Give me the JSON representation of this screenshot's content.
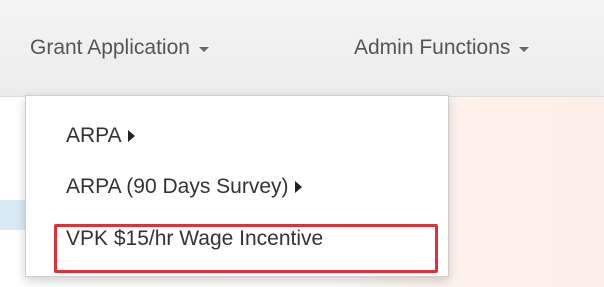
{
  "navbar": {
    "items": [
      {
        "label": "Grant Application",
        "icon": "caret-down-icon"
      },
      {
        "label": "Admin Functions",
        "icon": "caret-down-icon"
      }
    ]
  },
  "dropdown": {
    "items": [
      {
        "label": "ARPA",
        "icon": "caret-right-icon"
      },
      {
        "label": "ARPA (90 Days Survey)",
        "icon": "caret-right-icon"
      },
      {
        "label": "VPK $15/hr Wage Incentive"
      }
    ],
    "highlight_color": "#e0303a"
  }
}
